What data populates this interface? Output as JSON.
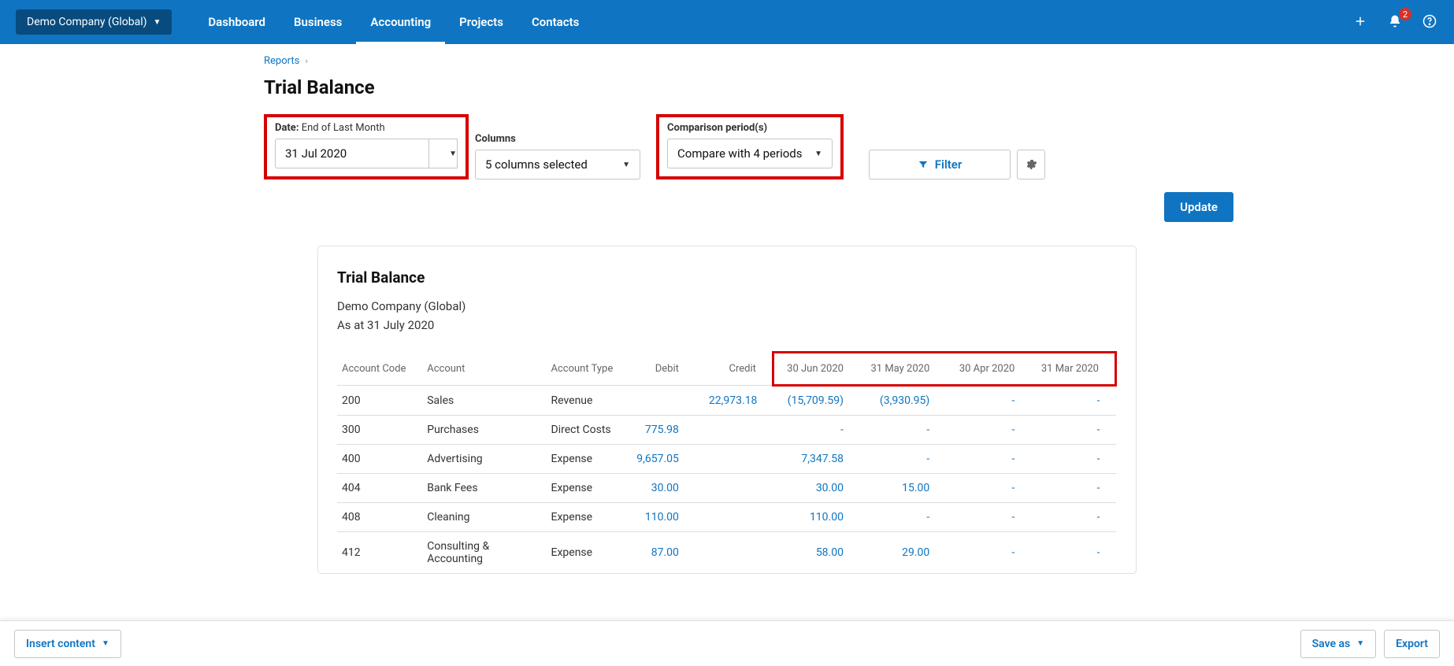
{
  "header": {
    "company": "Demo Company (Global)",
    "nav": [
      "Dashboard",
      "Business",
      "Accounting",
      "Projects",
      "Contacts"
    ],
    "active_nav": "Accounting",
    "notif_count": "2"
  },
  "breadcrumb": {
    "root": "Reports"
  },
  "page_title": "Trial Balance",
  "controls": {
    "date_label": "Date:",
    "date_desc": " End of Last Month",
    "date_value": "31 Jul 2020",
    "columns_label": "Columns",
    "columns_value": "5 columns selected",
    "compare_label": "Comparison period(s)",
    "compare_value": "Compare with 4 periods",
    "filter_label": "Filter",
    "update_label": "Update"
  },
  "report": {
    "title": "Trial Balance",
    "company": "Demo Company (Global)",
    "asat": "As at 31 July 2020",
    "columns": [
      "Account Code",
      "Account",
      "Account Type",
      "Debit",
      "Credit",
      "30 Jun 2020",
      "31 May 2020",
      "30 Apr 2020",
      "31 Mar 2020"
    ],
    "rows": [
      {
        "code": "200",
        "account": "Sales",
        "type": "Revenue",
        "debit": "",
        "credit": "22,973.18",
        "c1": "(15,709.59)",
        "c2": "(3,930.95)",
        "c3": "-",
        "c4": "-"
      },
      {
        "code": "300",
        "account": "Purchases",
        "type": "Direct Costs",
        "debit": "775.98",
        "credit": "",
        "c1": "-",
        "c2": "-",
        "c3": "-",
        "c4": "-"
      },
      {
        "code": "400",
        "account": "Advertising",
        "type": "Expense",
        "debit": "9,657.05",
        "credit": "",
        "c1": "7,347.58",
        "c2": "-",
        "c3": "-",
        "c4": "-"
      },
      {
        "code": "404",
        "account": "Bank Fees",
        "type": "Expense",
        "debit": "30.00",
        "credit": "",
        "c1": "30.00",
        "c2": "15.00",
        "c3": "-",
        "c4": "-"
      },
      {
        "code": "408",
        "account": "Cleaning",
        "type": "Expense",
        "debit": "110.00",
        "credit": "",
        "c1": "110.00",
        "c2": "-",
        "c3": "-",
        "c4": "-"
      },
      {
        "code": "412",
        "account": "Consulting & Accounting",
        "type": "Expense",
        "debit": "87.00",
        "credit": "",
        "c1": "58.00",
        "c2": "29.00",
        "c3": "-",
        "c4": "-"
      }
    ]
  },
  "bottom": {
    "insert": "Insert content",
    "saveas": "Save as",
    "export": "Export"
  }
}
